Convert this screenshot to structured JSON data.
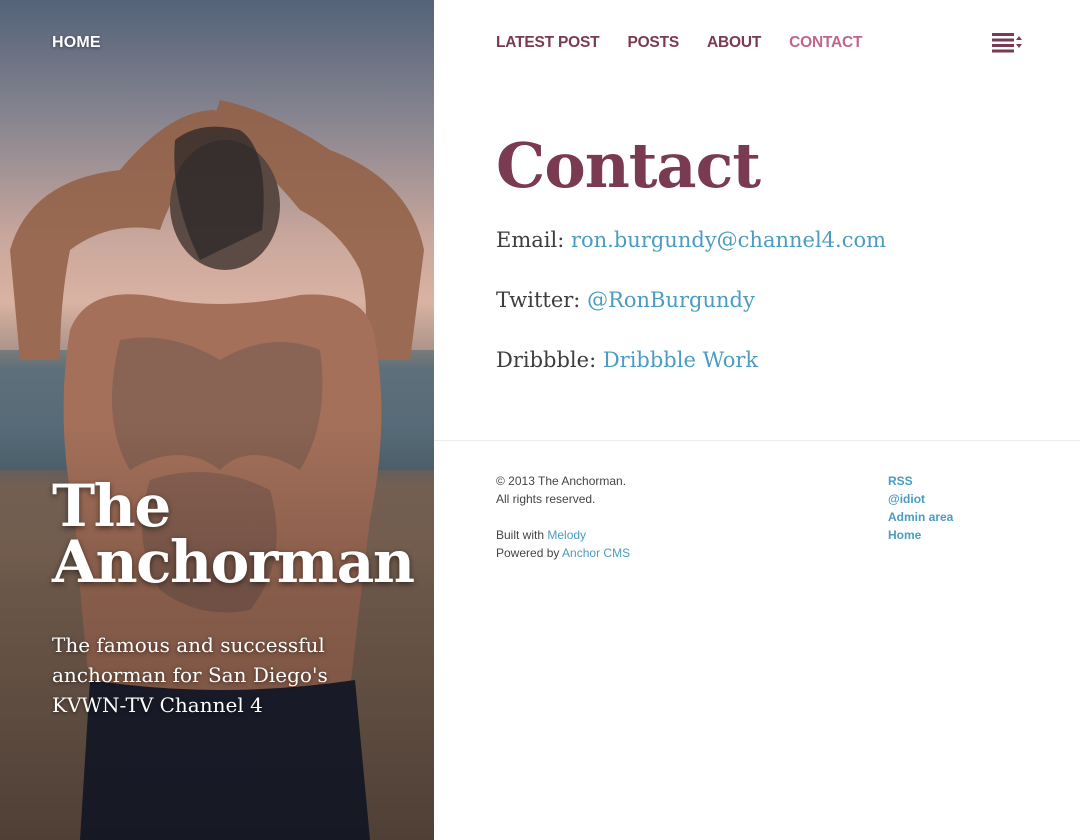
{
  "sidebar": {
    "home_label": "HOME",
    "site_title_line1": "The",
    "site_title_line2": "Anchorman",
    "site_description": "The famous and successful anchorman for San Diego's KVWN-TV Channel 4"
  },
  "nav": {
    "items": [
      {
        "label": "LATEST POST"
      },
      {
        "label": "POSTS"
      },
      {
        "label": "ABOUT"
      },
      {
        "label": "CONTACT",
        "active": true
      }
    ],
    "menu_icon": "menu-list-icon"
  },
  "page": {
    "title": "Contact",
    "contacts": [
      {
        "label": "Email:",
        "value": "ron.burgundy@channel4.com"
      },
      {
        "label": "Twitter:",
        "value": "@RonBurgundy"
      },
      {
        "label": "Dribbble:",
        "value": "Dribbble Work"
      }
    ]
  },
  "footer": {
    "copyright": "© 2013 The Anchorman.",
    "rights": "All rights reserved.",
    "built_with_prefix": "Built with",
    "built_with_link": "Melody",
    "powered_by_prefix": "Powered by",
    "powered_by_link": "Anchor CMS",
    "links": [
      {
        "label": "RSS"
      },
      {
        "label": "@idiot"
      },
      {
        "label": "Admin area"
      },
      {
        "label": "Home"
      }
    ]
  },
  "colors": {
    "brand": "#7a3a52",
    "active_nav": "#c0668a",
    "link": "#4a9cc2"
  }
}
